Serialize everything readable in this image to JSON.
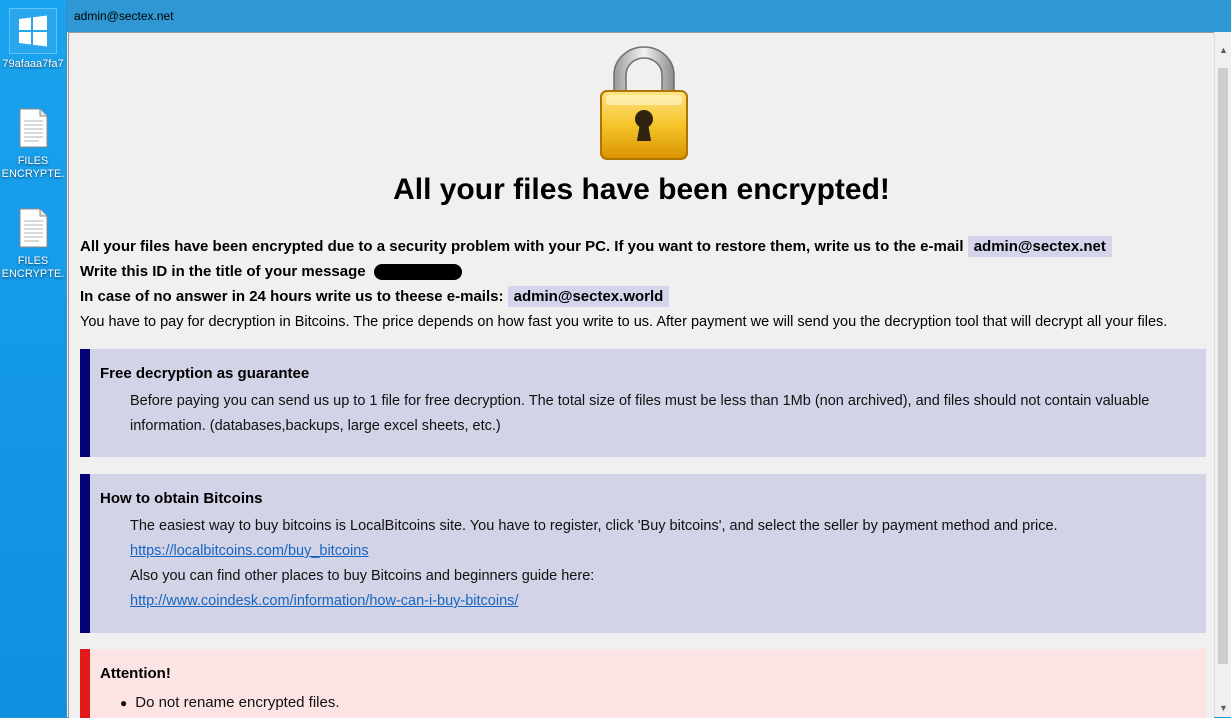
{
  "desktop": {
    "icons": [
      {
        "label": "79afaaa7fa7",
        "icon": "windows-logo-icon"
      },
      {
        "label1": "FILES",
        "label2": "ENCRYPTE.",
        "icon": "text-file-icon"
      },
      {
        "label1": "FILES",
        "label2": "ENCRYPTE.",
        "icon": "text-file-icon"
      }
    ]
  },
  "window": {
    "title": "admin@sectex.net"
  },
  "note": {
    "heading": "All your files have been encrypted!",
    "line1": "All your files have been encrypted due to a security problem with your PC. If you want to restore them, write us to the e-mail",
    "email1": "admin@sectex.net",
    "line2": "Write this ID in the title of your message",
    "line3": "In case of no answer in 24 hours write us to theese e-mails:",
    "email2": "admin@sectex.world",
    "line4": "You have to pay for decryption in Bitcoins. The price depends on how fast you write to us. After payment we will send you the decryption tool that will decrypt all your files.",
    "guarantee": {
      "title": "Free decryption as guarantee",
      "text": "Before paying you can send us up to 1 file for free decryption. The total size of files must be less than 1Mb (non archived), and files should not contain valuable information. (databases,backups, large excel sheets, etc.)"
    },
    "bitcoins": {
      "title": "How to obtain Bitcoins",
      "text1": "The easiest way to buy bitcoins is LocalBitcoins site. You have to register, click 'Buy bitcoins', and select the seller by payment method and price.",
      "link1": "https://localbitcoins.com/buy_bitcoins",
      "text2": "Also you can find other places to buy Bitcoins and beginners guide here:",
      "link2": "http://www.coindesk.com/information/how-can-i-buy-bitcoins/"
    },
    "attention": {
      "title": "Attention!",
      "bullet1": "Do not rename encrypted files."
    }
  },
  "colors": {
    "titlebar": "#2f97d4",
    "box_blue": "#d3d3e8",
    "box_blue_border": "#020276",
    "box_red": "#fde4e4",
    "box_red_border": "#e21a1a",
    "link": "#1665c0"
  }
}
